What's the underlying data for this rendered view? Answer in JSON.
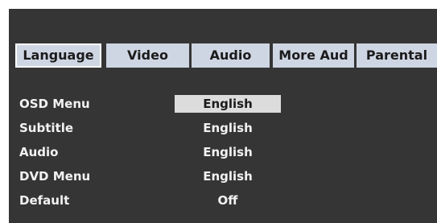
{
  "tabs": [
    {
      "label": "Language",
      "active": true
    },
    {
      "label": "Video",
      "active": false
    },
    {
      "label": "Audio",
      "active": false
    },
    {
      "label": "More Aud",
      "active": false
    },
    {
      "label": "Parental",
      "active": false
    }
  ],
  "settings": [
    {
      "label": "OSD Menu",
      "value": "English",
      "selected": true
    },
    {
      "label": "Subtitle",
      "value": "English",
      "selected": false
    },
    {
      "label": "Audio",
      "value": "English",
      "selected": false
    },
    {
      "label": "DVD Menu",
      "value": "English",
      "selected": false
    },
    {
      "label": "Default",
      "value": "Off",
      "selected": false
    }
  ],
  "colors": {
    "background": "#353535",
    "tab": "#cfd6e3",
    "highlight": "#dcdcdc",
    "text": "#f2f2f2"
  }
}
